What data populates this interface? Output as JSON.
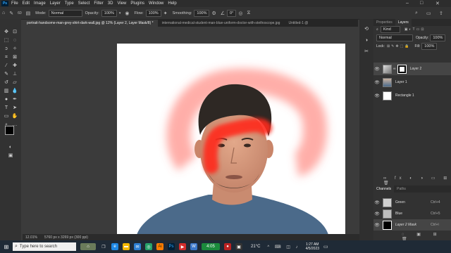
{
  "menu": {
    "items": [
      "File",
      "Edit",
      "Image",
      "Layer",
      "Type",
      "Select",
      "Filter",
      "3D",
      "View",
      "Plugins",
      "Window",
      "Help"
    ],
    "logo": "Ps"
  },
  "options": {
    "mode_label": "Mode:",
    "mode_value": "Normal",
    "opacity_label": "Opacity:",
    "opacity_value": "100%",
    "flow_label": "Flow:",
    "flow_value": "100%",
    "smoothing_label": "Smoothing:",
    "smoothing_value": "100%",
    "angle_value": "0°",
    "brush_size": "60"
  },
  "tabs": [
    {
      "label": "portrait-handsome-man-grey-shirt-dark-wall.jpg @ 12% (Layer 2, Layer Mask/8) *"
    },
    {
      "label": "international-medical-student-man-blue-uniform-doctor-with-stethoscope.jpg"
    },
    {
      "label": "Untitled-1 @"
    }
  ],
  "status": {
    "zoom": "12.01%",
    "doc_size": "5760 px x 3269 px (300 ppi)"
  },
  "panels": {
    "top_tabs": [
      "Properties",
      "Layers"
    ],
    "kind_label": "Kind",
    "blend_mode": "Normal",
    "opacity_label": "Opacity:",
    "opacity_value": "100%",
    "lock_label": "Lock:",
    "fill_label": "Fill:",
    "fill_value": "100%",
    "layers": [
      {
        "name": "Layer 2"
      },
      {
        "name": "Layer 1"
      },
      {
        "name": "Rectangle 1"
      }
    ],
    "bottom_tabs": [
      "Channels",
      "Paths"
    ],
    "channels": [
      {
        "name": "Green",
        "shortcut": "Ctrl+4"
      },
      {
        "name": "Blue",
        "shortcut": "Ctrl+5"
      },
      {
        "name": "Layer 2 Mask",
        "shortcut": "Ctrl+\\"
      }
    ]
  },
  "taskbar": {
    "search_placeholder": "Type here to search",
    "clock_chip": "4:05",
    "temperature": "21°C",
    "time": "1:27 AM",
    "date": "4/5/2023"
  },
  "colors": {
    "accent": "#31a8ff",
    "paint_red": "#ff2a1f",
    "canvas_bg": "#ffffff"
  }
}
